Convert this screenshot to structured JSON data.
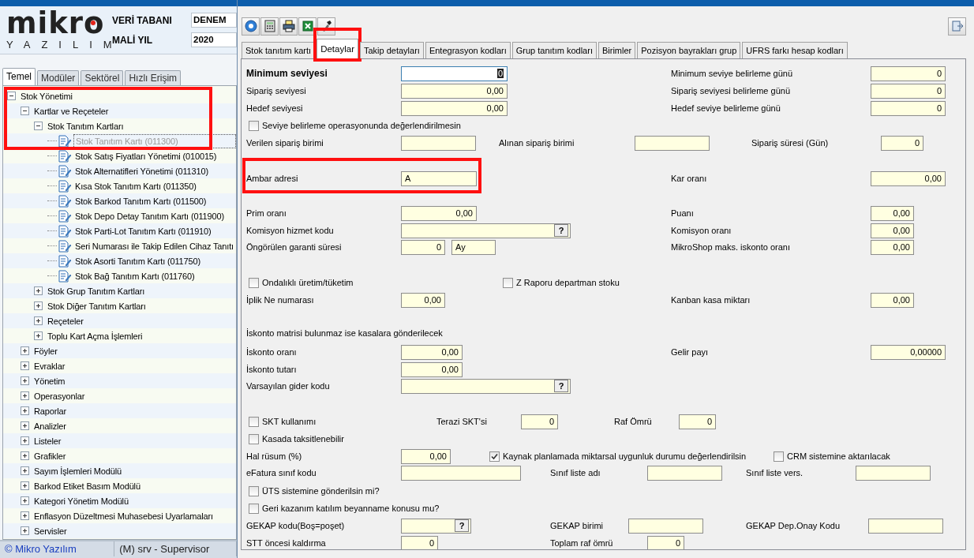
{
  "logo": {
    "name": "mikro",
    "tagline": "YAZILIM"
  },
  "header": {
    "database_label": "VERİ TABANI",
    "database_value": "DENEM",
    "year_label": "MALİ YIL",
    "year_value": "2020"
  },
  "left_tabs": [
    {
      "label": "Temel",
      "selected": true
    },
    {
      "label": "Modüler",
      "selected": false
    },
    {
      "label": "Sektörel",
      "selected": false
    },
    {
      "label": "Hızlı Erişim",
      "selected": false
    }
  ],
  "tree": {
    "highlighted": true,
    "items": [
      {
        "label": "Stok Yönetimi",
        "kind": "group",
        "expanded": true,
        "selected": false,
        "children": [
          {
            "label": "Kartlar ve Reçeteler",
            "kind": "group",
            "expanded": true,
            "selected": false,
            "children": [
              {
                "label": "Stok Tanıtım Kartları",
                "kind": "group",
                "expanded": true,
                "selected": false,
                "children": [
                  {
                    "label": "Stok Tanıtım Kartı (011300)",
                    "kind": "document",
                    "selected": true
                  },
                  {
                    "label": "Stok Satış Fiyatları Yönetimi (010015)",
                    "kind": "document",
                    "selected": false
                  },
                  {
                    "label": "Stok Alternatifleri Yönetimi (011310)",
                    "kind": "document",
                    "selected": false
                  },
                  {
                    "label": "Kısa Stok Tanıtım Kartı (011350)",
                    "kind": "document",
                    "selected": false
                  },
                  {
                    "label": "Stok Barkod Tanıtım Kartı (011500)",
                    "kind": "document",
                    "selected": false
                  },
                  {
                    "label": "Stok Depo Detay Tanıtım Kartı (011900)",
                    "kind": "document",
                    "selected": false
                  },
                  {
                    "label": "Stok Parti-Lot Tanıtım Kartı (011910)",
                    "kind": "document",
                    "selected": false
                  },
                  {
                    "label": "Seri Numarası ile Takip Edilen Cihaz Tanıtı",
                    "kind": "document",
                    "selected": false
                  },
                  {
                    "label": "Stok Asorti Tanıtım Kartı (011750)",
                    "kind": "document",
                    "selected": false
                  },
                  {
                    "label": "Stok Bağ Tanıtım Kartı (011760)",
                    "kind": "document",
                    "selected": false
                  }
                ]
              },
              {
                "label": "Stok Grup Tanıtım Kartları",
                "kind": "group",
                "expanded": false,
                "selected": false
              },
              {
                "label": "Stok Diğer Tanıtım Kartları",
                "kind": "group",
                "expanded": false,
                "selected": false
              },
              {
                "label": "Reçeteler",
                "kind": "group",
                "expanded": false,
                "selected": false
              },
              {
                "label": "Toplu Kart Açma İşlemleri",
                "kind": "group",
                "expanded": false,
                "selected": false
              }
            ]
          },
          {
            "label": "Föyler",
            "kind": "group",
            "expanded": false,
            "selected": false
          },
          {
            "label": "Evraklar",
            "kind": "group",
            "expanded": false,
            "selected": false
          },
          {
            "label": "Yönetim",
            "kind": "group",
            "expanded": false,
            "selected": false
          },
          {
            "label": "Operasyonlar",
            "kind": "group",
            "expanded": false,
            "selected": false
          },
          {
            "label": "Raporlar",
            "kind": "group",
            "expanded": false,
            "selected": false
          },
          {
            "label": "Analizler",
            "kind": "group",
            "expanded": false,
            "selected": false
          },
          {
            "label": "Listeler",
            "kind": "group",
            "expanded": false,
            "selected": false
          },
          {
            "label": "Grafikler",
            "kind": "group",
            "expanded": false,
            "selected": false
          },
          {
            "label": "Sayım İşlemleri Modülü",
            "kind": "group",
            "expanded": false,
            "selected": false
          },
          {
            "label": "Barkod Etiket Basım Modülü",
            "kind": "group",
            "expanded": false,
            "selected": false
          },
          {
            "label": "Kategori Yönetim Modülü",
            "kind": "group",
            "expanded": false,
            "selected": false
          },
          {
            "label": "Enflasyon Düzeltmesi Muhasebesi Uyarlamaları",
            "kind": "group",
            "expanded": false,
            "selected": false
          },
          {
            "label": "Servisler",
            "kind": "group",
            "expanded": false,
            "selected": false
          }
        ]
      }
    ]
  },
  "status_bar": {
    "company": "© Mikro Yazılım",
    "user": "(M) srv - Supervisor"
  },
  "tabs": [
    {
      "label": "Stok tanıtım kartı",
      "selected": false,
      "highlighted": false
    },
    {
      "label": "Detaylar",
      "selected": true,
      "highlighted": true
    },
    {
      "label": "Takip detayları",
      "selected": false,
      "highlighted": false
    },
    {
      "label": "Entegrasyon kodları",
      "selected": false,
      "highlighted": false
    },
    {
      "label": "Grup tanıtım kodları",
      "selected": false,
      "highlighted": false
    },
    {
      "label": "Birimler",
      "selected": false,
      "highlighted": false
    },
    {
      "label": "Pozisyon bayrakları grup",
      "selected": false,
      "highlighted": false
    },
    {
      "label": "UFRS farkı hesap kodları",
      "selected": false,
      "highlighted": false
    }
  ],
  "form": {
    "rows": [
      {
        "items": [
          {
            "kind": "heading",
            "text": "Minimum seviyesi"
          },
          {
            "kind": "number",
            "value": "0",
            "focused": true
          },
          {
            "kind": "label",
            "text": "Minimum seviye belirleme günü"
          },
          {
            "kind": "number",
            "value": "0"
          }
        ]
      },
      {
        "items": [
          {
            "kind": "label",
            "text": "Sipariş seviyesi"
          },
          {
            "kind": "number",
            "value": "0,00"
          },
          {
            "kind": "label",
            "text": "Sipariş seviyesi belirleme günü"
          },
          {
            "kind": "number",
            "value": "0"
          }
        ]
      },
      {
        "items": [
          {
            "kind": "label",
            "text": "Hedef seviyesi"
          },
          {
            "kind": "number",
            "value": "0,00"
          },
          {
            "kind": "label",
            "text": "Hedef seviye belirleme günü"
          },
          {
            "kind": "number",
            "value": "0"
          }
        ]
      },
      {
        "items": [
          {
            "kind": "check",
            "label": "Seviye belirleme operasyonunda değerlendirilmesin",
            "checked": false
          }
        ]
      },
      {
        "items": [
          {
            "kind": "label",
            "text": "Verilen sipariş birimi"
          },
          {
            "kind": "text"
          },
          {
            "kind": "label",
            "text": "Alınan sipariş birimi"
          },
          {
            "kind": "text"
          },
          {
            "kind": "label",
            "text": "Sipariş süresi (Gün)"
          },
          {
            "kind": "number",
            "value": "0"
          }
        ]
      },
      {
        "highlighted": true,
        "items": [
          {
            "kind": "label",
            "text": "Ambar adresi"
          },
          {
            "kind": "text",
            "value": "A"
          },
          {
            "kind": "label",
            "text": "Kar oranı"
          },
          {
            "kind": "number",
            "value": "0,00"
          }
        ]
      },
      {
        "items": [
          {
            "kind": "label",
            "text": "Prim oranı"
          },
          {
            "kind": "number",
            "value": "0,00"
          },
          {
            "kind": "label",
            "text": "Puanı"
          },
          {
            "kind": "number",
            "value": "0,00"
          }
        ]
      },
      {
        "items": [
          {
            "kind": "label",
            "text": "Komisyon hizmet kodu"
          },
          {
            "kind": "lookup",
            "button": "?"
          },
          {
            "kind": "label",
            "text": "Komisyon oranı"
          },
          {
            "kind": "number",
            "value": "0,00"
          }
        ]
      },
      {
        "items": [
          {
            "kind": "label",
            "text": "Öngörülen garanti süresi"
          },
          {
            "kind": "number",
            "value": "0"
          },
          {
            "kind": "text",
            "value": "Ay"
          },
          {
            "kind": "label",
            "text": "MikroShop maks. iskonto oranı"
          },
          {
            "kind": "number",
            "value": "0,00"
          }
        ]
      },
      {
        "items": [
          {
            "kind": "check",
            "label": "Ondalıklı üretim/tüketim",
            "checked": false
          },
          {
            "kind": "check",
            "label": "Z Raporu departman stoku",
            "checked": false
          }
        ]
      },
      {
        "items": [
          {
            "kind": "label",
            "text": "İplik Ne numarası"
          },
          {
            "kind": "number",
            "value": "0,00"
          },
          {
            "kind": "label",
            "text": "Kanban kasa miktarı"
          },
          {
            "kind": "number",
            "value": "0,00"
          }
        ]
      },
      {
        "items": [
          {
            "kind": "note",
            "text": "İskonto matrisi bulunmaz ise kasalara gönderilecek"
          }
        ]
      },
      {
        "items": [
          {
            "kind": "label",
            "text": "İskonto oranı"
          },
          {
            "kind": "number",
            "value": "0,00"
          },
          {
            "kind": "label",
            "text": "Gelir payı"
          },
          {
            "kind": "number",
            "value": "0,00000"
          }
        ]
      },
      {
        "items": [
          {
            "kind": "label",
            "text": "İskonto tutarı"
          },
          {
            "kind": "number",
            "value": "0,00"
          }
        ]
      },
      {
        "items": [
          {
            "kind": "label",
            "text": "Varsayılan gider kodu"
          },
          {
            "kind": "lookup",
            "button": "?"
          }
        ]
      },
      {
        "items": [
          {
            "kind": "check",
            "label": "SKT kullanımı",
            "checked": false
          },
          {
            "kind": "label",
            "text": "Terazi SKT'si"
          },
          {
            "kind": "number",
            "value": "0"
          },
          {
            "kind": "label",
            "text": "Raf Ömrü"
          },
          {
            "kind": "number",
            "value": "0"
          }
        ]
      },
      {
        "items": [
          {
            "kind": "check",
            "label": "Kasada taksitlenebilir",
            "checked": false
          }
        ]
      },
      {
        "items": [
          {
            "kind": "label",
            "text": "Hal rüsum (%)"
          },
          {
            "kind": "number",
            "value": "0,00"
          },
          {
            "kind": "check",
            "label": "Kaynak planlamada miktarsal uygunluk durumu değerlendirilsin",
            "checked": true
          },
          {
            "kind": "check",
            "label": "CRM sistemine aktarılacak",
            "checked": false
          }
        ]
      },
      {
        "items": [
          {
            "kind": "label",
            "text": "eFatura sınıf kodu"
          },
          {
            "kind": "text"
          },
          {
            "kind": "label",
            "text": "Sınıf liste adı"
          },
          {
            "kind": "text"
          },
          {
            "kind": "label",
            "text": "Sınıf liste vers."
          },
          {
            "kind": "text"
          }
        ]
      },
      {
        "items": [
          {
            "kind": "check",
            "label": "ÜTS sistemine gönderilsin mi?",
            "checked": false
          }
        ]
      },
      {
        "items": [
          {
            "kind": "check",
            "label": "Geri kazanım katılım beyanname konusu mu?",
            "checked": false
          }
        ]
      },
      {
        "items": [
          {
            "kind": "label",
            "text": "GEKAP kodu(Boş=poşet)"
          },
          {
            "kind": "lookup",
            "button": "?"
          },
          {
            "kind": "label",
            "text": "GEKAP birimi"
          },
          {
            "kind": "text"
          },
          {
            "kind": "label",
            "text": "GEKAP Dep.Onay Kodu"
          },
          {
            "kind": "text"
          }
        ]
      },
      {
        "items": [
          {
            "kind": "label",
            "text": "STT öncesi kaldırma"
          },
          {
            "kind": "number",
            "value": "0"
          },
          {
            "kind": "label",
            "text": "Toplam raf ömrü"
          },
          {
            "kind": "number",
            "value": "0"
          }
        ]
      }
    ]
  }
}
